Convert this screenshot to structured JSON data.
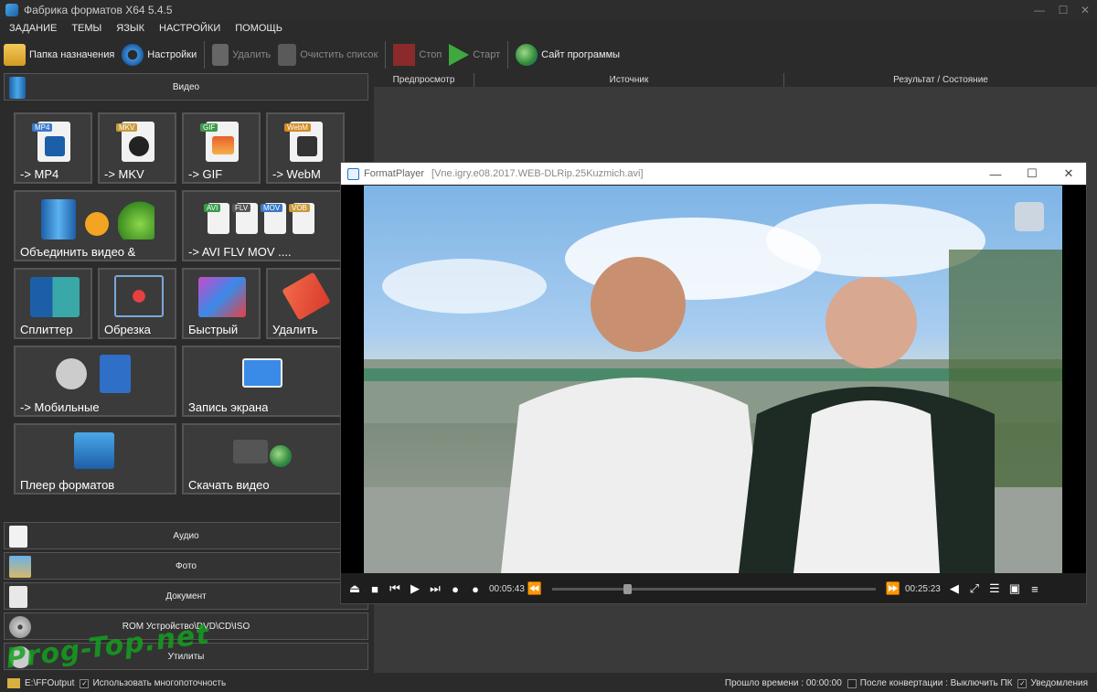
{
  "window": {
    "title": "Фабрика форматов X64 5.4.5"
  },
  "menu": [
    "ЗАДАНИЕ",
    "ТЕМЫ",
    "ЯЗЫК",
    "НАСТРОЙКИ",
    "ПОМОЩЬ"
  ],
  "toolbar": {
    "dest_folder": "Папка назначения",
    "settings": "Настройки",
    "delete": "Удалить",
    "clear_list": "Очистить список",
    "stop": "Стоп",
    "start": "Старт",
    "website": "Сайт программы"
  },
  "categories": {
    "video": "Видео",
    "audio": "Аудио",
    "photo": "Фото",
    "document": "Документ",
    "rom": "ROM Устройство\\DVD\\CD\\ISO",
    "utils": "Утилиты"
  },
  "tiles": {
    "mp4": {
      "label": "-> MP4",
      "badge": "MP4"
    },
    "mkv": {
      "label": "-> MKV",
      "badge": "MKV"
    },
    "gif": {
      "label": "-> GIF",
      "badge": "GIF"
    },
    "webm": {
      "label": "-> WebM",
      "badge": "WebM"
    },
    "merge": {
      "label": "Объединить видео &"
    },
    "avi": {
      "label": "-> AVI FLV MOV ....",
      "badges": [
        "AVI",
        "FLV",
        "MOV",
        "VOB"
      ]
    },
    "splitter": {
      "label": "Сплиттер"
    },
    "crop": {
      "label": "Обрезка"
    },
    "fast": {
      "label": "Быстрый"
    },
    "remove": {
      "label": "Удалить"
    },
    "mobile": {
      "label": "-> Мобильные"
    },
    "screen": {
      "label": "Запись экрана"
    },
    "player": {
      "label": "Плеер форматов"
    },
    "download": {
      "label": "Скачать видео"
    }
  },
  "columns": {
    "preview": "Предпросмотр",
    "source": "Источник",
    "result": "Результат / Состояние"
  },
  "player": {
    "name": "FormatPlayer",
    "file": "[Vne.igry.e08.2017.WEB-DLRip.25Kuzmich.avi]",
    "current_time": "00:05:43",
    "total_time": "00:25:23",
    "progress": 0.225
  },
  "status": {
    "output_path": "E:\\FFOutput",
    "multithread": "Использовать многопоточность",
    "elapsed": "Прошло времени : 00:00:00",
    "after_convert": "После конвертации : Выключить ПК",
    "notify": "Уведомления"
  },
  "watermark": "Prog-Top.net"
}
